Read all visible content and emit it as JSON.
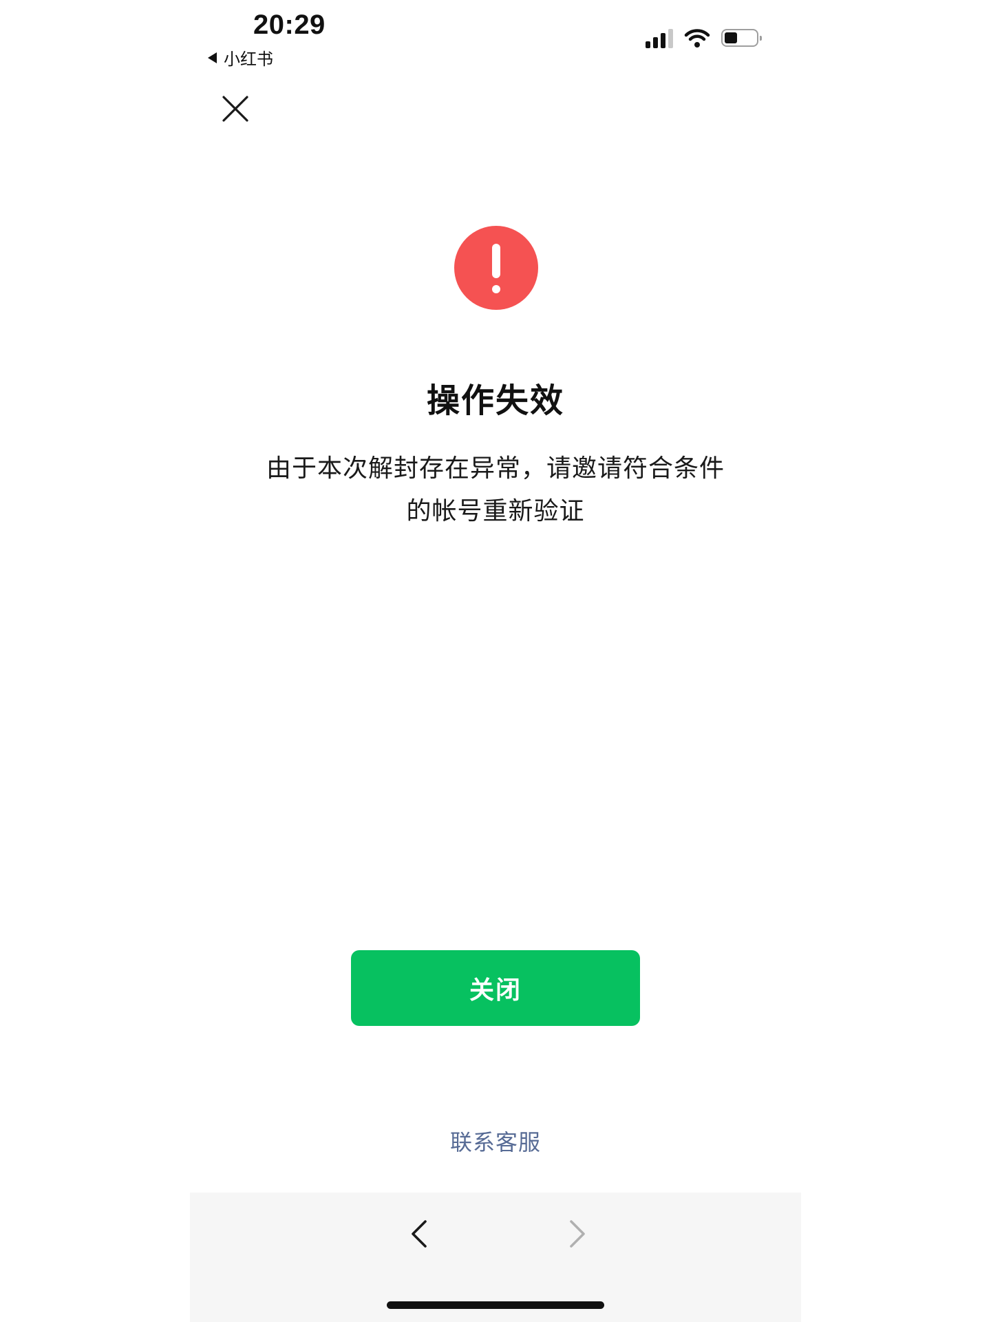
{
  "status_bar": {
    "time": "20:29",
    "back_app_label": "小红书",
    "signal_bars_active": 3,
    "signal_bars_total": 4,
    "battery_level": 0.4
  },
  "icons": {
    "close": "close-icon",
    "alert": "exclamation-circle-icon",
    "back": "chevron-left-icon",
    "forward": "chevron-right-icon",
    "wifi": "wifi-icon",
    "signal": "cellular-signal-icon",
    "battery": "battery-icon"
  },
  "content": {
    "title": "操作失效",
    "message_line1": "由于本次解封存在异常，请邀请符合条件",
    "message_line2": "的帐号重新验证"
  },
  "actions": {
    "close_label": "关闭",
    "contact_label": "联系客服"
  },
  "colors": {
    "alert": "#f55252",
    "primary_button": "#07c160",
    "link": "#576b95",
    "bottom_bar": "#f6f6f6"
  }
}
